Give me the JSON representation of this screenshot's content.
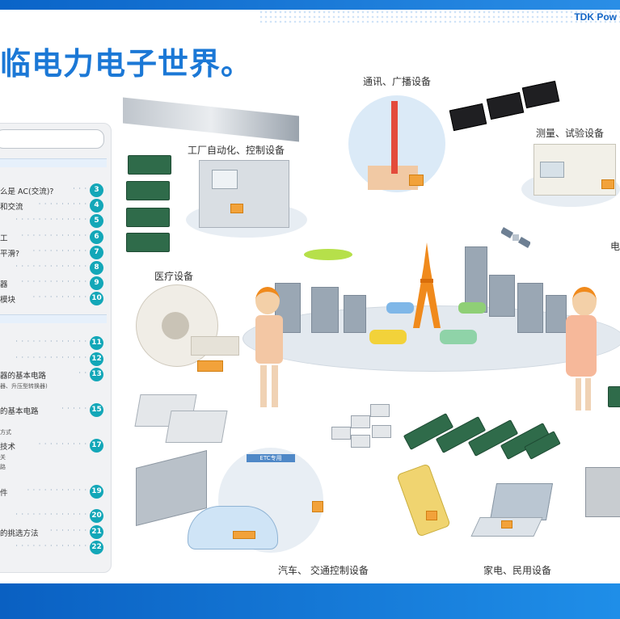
{
  "brand": "TDK Pow",
  "headline": "临电力电子世界。",
  "sidebar": {
    "items": [
      {
        "text": "么是 AC(交流)?",
        "num": "3"
      },
      {
        "text": "和交流",
        "num": "4"
      },
      {
        "text": "",
        "num": "5"
      },
      {
        "text": "工",
        "num": "6"
      },
      {
        "text": "平滑?",
        "num": "7"
      },
      {
        "text": "",
        "num": "8"
      },
      {
        "text": "器",
        "num": "9"
      },
      {
        "text": "模块",
        "num": "10"
      },
      {
        "text": "",
        "num": "11"
      },
      {
        "text": "",
        "num": "12"
      },
      {
        "text": "器的基本电路",
        "num": "13"
      },
      {
        "text": "的基本电路",
        "num": "15"
      },
      {
        "text": "技术",
        "num": "17"
      },
      {
        "text": "件",
        "num": "19"
      },
      {
        "text": "",
        "num": "20"
      },
      {
        "text": "的挑选方法",
        "num": "21"
      },
      {
        "text": "",
        "num": "22"
      }
    ],
    "sub_13": "器、升压型转换器)",
    "sub_17a": "方式",
    "sub_17b": "关",
    "sub_17c": "路"
  },
  "labels": {
    "telecom": "通讯、广播设备",
    "factory": "工厂自动化、控制设备",
    "measure": "测量、试验设备",
    "medical": "医疗设备",
    "auto": "汽车、 交通控制设备",
    "home": "家电、民用设备",
    "partial_right": "电",
    "etc_sign": "ETC专用"
  },
  "colors": {
    "accent_blue": "#1b78d6",
    "number_badge": "#13a7b8",
    "module_orange": "#f2a23a"
  }
}
